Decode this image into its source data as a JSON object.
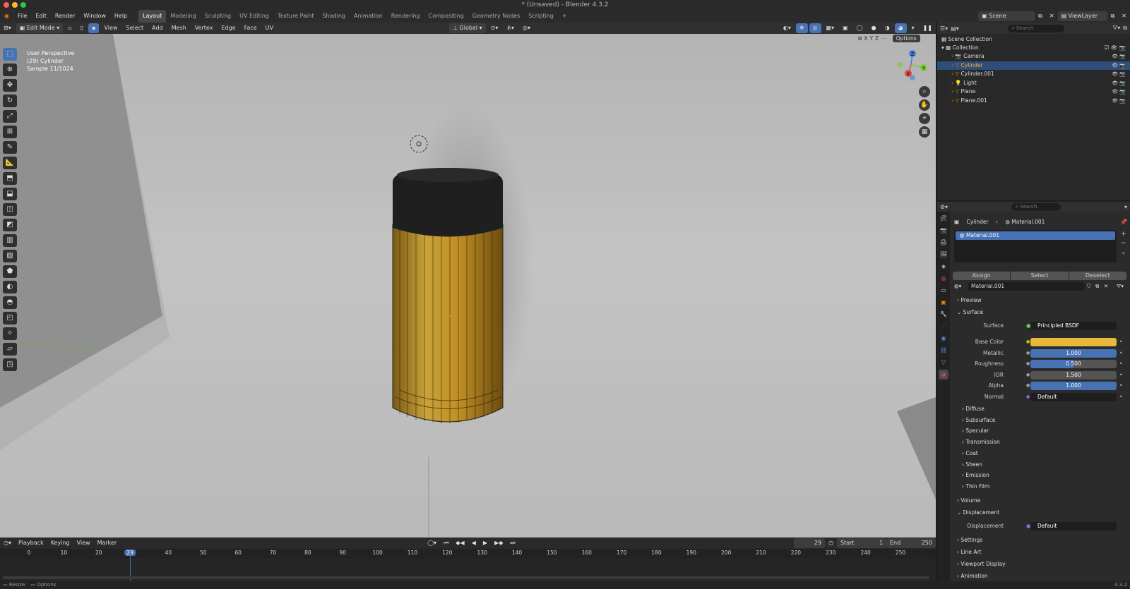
{
  "window": {
    "title": "* (Unsaved) - Blender 4.3.2"
  },
  "menus": [
    "File",
    "Edit",
    "Render",
    "Window",
    "Help"
  ],
  "workspaces": [
    "Layout",
    "Modeling",
    "Sculpting",
    "UV Editing",
    "Texture Paint",
    "Shading",
    "Animation",
    "Rendering",
    "Compositing",
    "Geometry Nodes",
    "Scripting",
    "+"
  ],
  "scene": {
    "name": "Scene",
    "view_layer": "ViewLayer"
  },
  "viewport_header": {
    "mode": "Edit Mode",
    "menus": [
      "View",
      "Select",
      "Add",
      "Mesh",
      "Vertex",
      "Edge",
      "Face",
      "UV"
    ],
    "orientation": "Global",
    "options": "Options",
    "axes": [
      "X",
      "Y",
      "Z"
    ]
  },
  "viewport": {
    "line1": "User Perspective",
    "line2": "(29) Cylinder",
    "line3": "Sample 11/1024",
    "gizmo": {
      "z": "Z",
      "y": "Y",
      "x": "X"
    },
    "colors": {
      "object_gold": "#c9a23a",
      "cap": "#1f1f1f",
      "x_axis": "#e04646",
      "y_axis": "#7ec83c",
      "z_axis": "#4a7fdc"
    }
  },
  "outliner": {
    "search_placeholder": "Search",
    "root": "Scene Collection",
    "collection": "Collection",
    "items": [
      {
        "name": "Camera",
        "selected": false
      },
      {
        "name": "Cylinder",
        "selected": true
      },
      {
        "name": "Cylinder.001",
        "selected": false
      },
      {
        "name": "Light",
        "selected": false
      },
      {
        "name": "Plane",
        "selected": false
      },
      {
        "name": "Plane.001",
        "selected": false
      }
    ]
  },
  "properties": {
    "search_placeholder": "Search",
    "breadcrumb_object": "Cylinder",
    "breadcrumb_material": "Material.001",
    "slot": "Material.001",
    "assign": "Assign",
    "select": "Select",
    "deselect": "Deselect",
    "material_name": "Material.001",
    "preview": "Preview",
    "surface_section": "Surface",
    "surface_label": "Surface",
    "surface_value": "Principled BSDF",
    "fields": [
      {
        "label": "Base Color",
        "value": "",
        "kind": "color",
        "color": "#e8b83a"
      },
      {
        "label": "Metallic",
        "value": "1.000",
        "kind": "slider",
        "fill": 1.0
      },
      {
        "label": "Roughness",
        "value": "0.500",
        "kind": "slider",
        "fill": 0.5
      },
      {
        "label": "IOR",
        "value": "1.500",
        "kind": "slider",
        "fill": 0.0
      },
      {
        "label": "Alpha",
        "value": "1.000",
        "kind": "slider",
        "fill": 1.0
      },
      {
        "label": "Normal",
        "value": "Default",
        "kind": "link"
      }
    ],
    "subpanels": [
      "Diffuse",
      "Subsurface",
      "Specular",
      "Transmission",
      "Coat",
      "Sheen",
      "Emission",
      "Thin Film"
    ],
    "volume": "Volume",
    "displacement_section": "Displacement",
    "displacement_label": "Displacement",
    "displacement_value": "Default",
    "bottom": [
      "Settings",
      "Line Art",
      "Viewport Display",
      "Animation"
    ]
  },
  "timeline": {
    "menus": [
      "Playback",
      "Keying",
      "View",
      "Marker"
    ],
    "current_frame": "29",
    "start_label": "Start",
    "start": "1",
    "end_label": "End",
    "end": "250",
    "ticks": [
      "0",
      "10",
      "20",
      "29",
      "40",
      "50",
      "60",
      "70",
      "80",
      "90",
      "100",
      "110",
      "120",
      "130",
      "140",
      "150",
      "160",
      "170",
      "180",
      "190",
      "200",
      "210",
      "220",
      "230",
      "240",
      "250"
    ]
  },
  "status": {
    "left1": "Resize",
    "left2": "Options",
    "version": "4.3.2"
  }
}
